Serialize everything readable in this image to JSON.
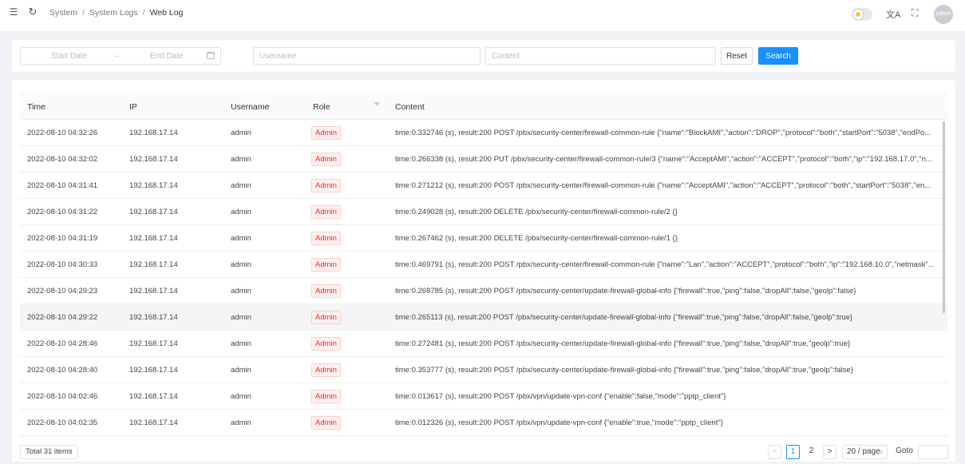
{
  "header": {
    "breadcrumb": [
      "System",
      "System Logs",
      "Web Log"
    ],
    "breadcrumb_sep": "/",
    "avatar_label": "admin",
    "lang_glyph": "文A"
  },
  "filters": {
    "start_date_placeholder": "Start Date",
    "arrow": "→",
    "end_date_placeholder": "End Date",
    "username_placeholder": "Username",
    "content_placeholder": "Content",
    "reset_label": "Reset",
    "search_label": "Search"
  },
  "table": {
    "columns": [
      "Time",
      "IP",
      "Username",
      "Role",
      "Content"
    ],
    "rows": [
      {
        "time": "2022-08-10 04:32:26",
        "ip": "192.168.17.14",
        "username": "admin",
        "role": "Admin",
        "content": "time:0.332746 (s), result:200 POST /pbx/security-center/firewall-common-rule {\"name\":\"BlockAMI\",\"action\":\"DROP\",\"protocol\":\"both\",\"startPort\":\"5038\",\"endPo..."
      },
      {
        "time": "2022-08-10 04:32:02",
        "ip": "192.168.17.14",
        "username": "admin",
        "role": "Admin",
        "content": "time:0.266338 (s), result:200 PUT /pbx/security-center/firewall-common-rule/3 {\"name\":\"AcceptAMI\",\"action\":\"ACCEPT\",\"protocol\":\"both\",\"ip\":\"192.168.17.0\",\"n..."
      },
      {
        "time": "2022-08-10 04:31:41",
        "ip": "192.168.17.14",
        "username": "admin",
        "role": "Admin",
        "content": "time:0.271212 (s), result:200 POST /pbx/security-center/firewall-common-rule {\"name\":\"AcceptAMI\",\"action\":\"ACCEPT\",\"protocol\":\"both\",\"startPort\":\"5038\",\"en..."
      },
      {
        "time": "2022-08-10 04:31:22",
        "ip": "192.168.17.14",
        "username": "admin",
        "role": "Admin",
        "content": "time:0.249028 (s), result:200 DELETE /pbx/security-center/firewall-common-rule/2 {}"
      },
      {
        "time": "2022-08-10 04:31:19",
        "ip": "192.168.17.14",
        "username": "admin",
        "role": "Admin",
        "content": "time:0.267462 (s), result:200 DELETE /pbx/security-center/firewall-common-rule/1 {}"
      },
      {
        "time": "2022-08-10 04:30:33",
        "ip": "192.168.17.14",
        "username": "admin",
        "role": "Admin",
        "content": "time:0.469791 (s), result:200 POST /pbx/security-center/firewall-common-rule {\"name\":\"Lan\",\"action\":\"ACCEPT\",\"protocol\":\"both\",\"ip\":\"192.168.10.0\",\"netmask\"..."
      },
      {
        "time": "2022-08-10 04:29:23",
        "ip": "192.168.17.14",
        "username": "admin",
        "role": "Admin",
        "content": "time:0.268785 (s), result:200 POST /pbx/security-center/update-firewall-global-info {\"firewall\":true,\"ping\":false,\"dropAll\":false,\"geolp\":false}"
      },
      {
        "time": "2022-08-10 04:29:22",
        "ip": "192.168.17.14",
        "username": "admin",
        "role": "Admin",
        "content": "time:0.265113 (s), result:200 POST /pbx/security-center/update-firewall-global-info {\"firewall\":true,\"ping\":false,\"dropAll\":false,\"geolp\":true}"
      },
      {
        "time": "2022-08-10 04:28:46",
        "ip": "192.168.17.14",
        "username": "admin",
        "role": "Admin",
        "content": "time:0.272481 (s), result:200 POST /pbx/security-center/update-firewall-global-info {\"firewall\":true,\"ping\":false,\"dropAll\":true,\"geolp\":true}"
      },
      {
        "time": "2022-08-10 04:28:40",
        "ip": "192.168.17.14",
        "username": "admin",
        "role": "Admin",
        "content": "time:0.353777 (s), result:200 POST /pbx/security-center/update-firewall-global-info {\"firewall\":true,\"ping\":false,\"dropAll\":true,\"geolp\":false}"
      },
      {
        "time": "2022-08-10 04:02:46",
        "ip": "192.168.17.14",
        "username": "admin",
        "role": "Admin",
        "content": "time:0.013617 (s), result:200 POST /pbx/vpn/update-vpn-conf {\"enable\":false,\"mode\":\"pptp_client\"}"
      },
      {
        "time": "2022-08-10 04:02:35",
        "ip": "192.168.17.14",
        "username": "admin",
        "role": "Admin",
        "content": "time:0.012326 (s), result:200 POST /pbx/vpn/update-vpn-conf {\"enable\":true,\"mode\":\"pptp_client\"}"
      }
    ]
  },
  "footer": {
    "total": "Total 31 items",
    "prev": "<",
    "page1": "1",
    "page2": "2",
    "next": ">",
    "page_size": "20 / page",
    "goto_label": "Goto"
  }
}
